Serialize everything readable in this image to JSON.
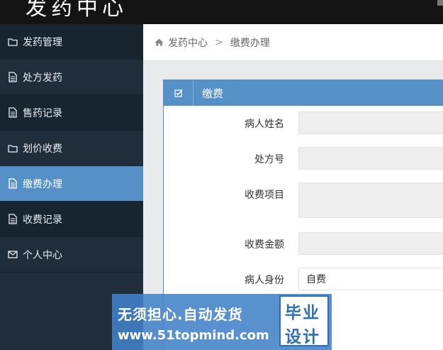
{
  "app": {
    "brand": "发药中心"
  },
  "sidebar": {
    "items": [
      {
        "label": "发药管理",
        "icon": "folder-icon"
      },
      {
        "label": "处方发药",
        "icon": "file-icon"
      },
      {
        "label": "售药记录",
        "icon": "file-icon"
      },
      {
        "label": "划价收费",
        "icon": "folder-icon"
      },
      {
        "label": "缴费办理",
        "icon": "file-icon",
        "active": true
      },
      {
        "label": "收费记录",
        "icon": "file-icon"
      },
      {
        "label": "个人中心",
        "icon": "envelope-icon"
      }
    ]
  },
  "breadcrumb": {
    "home": "发药中心",
    "separator": ">",
    "current": "缴费办理"
  },
  "panel": {
    "title": "缴费",
    "fields": {
      "patient_name": {
        "label": "病人姓名",
        "value": ""
      },
      "prescription_no": {
        "label": "处方号",
        "value": ""
      },
      "items": {
        "label": "收费项目",
        "value": ""
      },
      "amount": {
        "label": "收费金额",
        "value": ""
      },
      "identity": {
        "label": "病人身份",
        "value": "自费"
      }
    }
  },
  "watermark": {
    "line1": "无须担心.自动发货",
    "line2": "www.51topmind.com",
    "badge_line1": "毕业",
    "badge_line2": "设计"
  },
  "colors": {
    "accent": "#5590c6",
    "sidebar_bg": "#1f2e3a",
    "topbar_bg": "#141414"
  }
}
